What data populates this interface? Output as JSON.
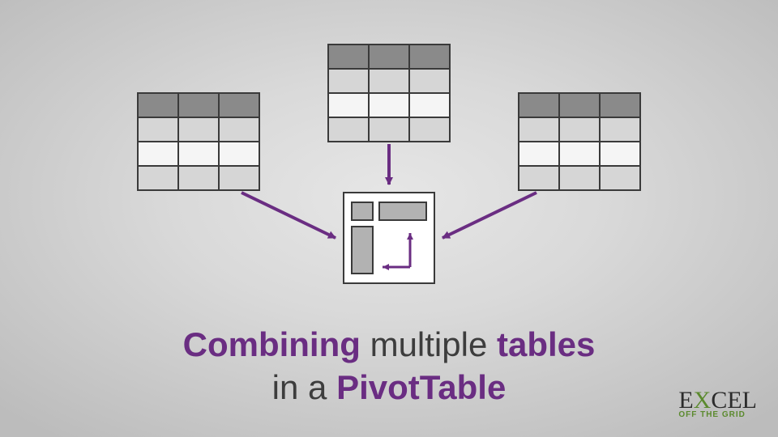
{
  "caption": {
    "w1": "Combining",
    "w2": "multiple",
    "w3": "tables",
    "w4": "in a",
    "w5": "PivotTable"
  },
  "logo": {
    "e": "E",
    "x": "X",
    "cel": "CEL",
    "tagline": "OFF THE GRID"
  },
  "colors": {
    "arrow": "#6a2d82",
    "tableHeader": "#8a8a8a",
    "tableRowA": "#d6d6d6",
    "tableRowB": "#f5f5f5",
    "tableBorder": "#3a3a3a",
    "pivotBg": "#ffffff",
    "pivotBorder": "#3a3a3a",
    "pivotBlock": "#b2b2b2"
  },
  "diagram": {
    "tables": 3,
    "tableCols": 3,
    "tableRows": 4,
    "description": "Three data tables with arrows converging into a single PivotTable icon"
  }
}
